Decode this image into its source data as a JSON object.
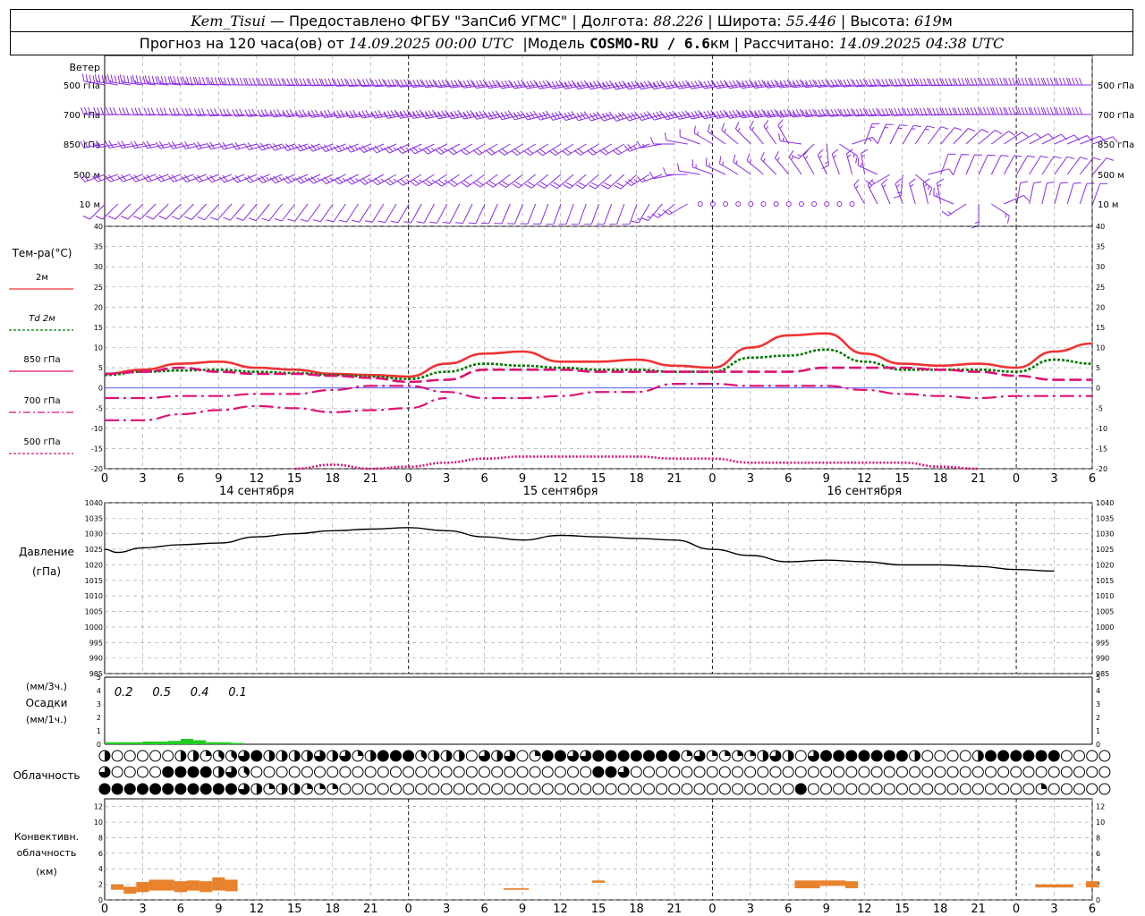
{
  "header": {
    "station": "Kem_Tisui",
    "provider": "— Предоставлено ФГБУ \"ЗапСиб УГМС\"",
    "lon_label": "Долгота:",
    "lon_value": "88.226",
    "lat_label": "Широта:",
    "lat_value": "55.446",
    "alt_label": "Высота:",
    "alt_value": "619",
    "alt_unit": "м",
    "forecast_prefix": "Прогноз на 120 часа(ов) от",
    "forecast_start": "14.09.2025 00:00 UTC",
    "model_label": "Модель",
    "model_name": "COSMO-RU / 6.6",
    "model_unit": "км",
    "calc_label": "Рассчитано:",
    "calc_time": "14.09.2025 04:38 UTC",
    "sep": "|"
  },
  "colors": {
    "wind": "#8a2be2",
    "t2m": "#ee3333",
    "td2m": "#007700",
    "t850": "#dd1177",
    "t700": "#dd1177",
    "t500": "#dd1177",
    "pressure": "#000000",
    "precip": "#22cc22",
    "conv": "#e8822c",
    "grid": "#999999"
  },
  "time_axis": {
    "hour_ticks": [
      "0",
      "3",
      "6",
      "9",
      "12",
      "15",
      "18",
      "21",
      "0",
      "3",
      "6",
      "9",
      "12",
      "15",
      "18",
      "21",
      "0",
      "3",
      "6",
      "9",
      "12",
      "15",
      "18",
      "21",
      "0",
      "3",
      "6"
    ],
    "dates": [
      "14 сентября",
      "15 сентября",
      "16 сентября"
    ]
  },
  "wind_panel": {
    "title": "Ветер",
    "levels": [
      "500 гПа",
      "700 гПа",
      "850 гПа",
      "500  м",
      "10   м"
    ]
  },
  "temp_panel": {
    "title": "Тем-ра(°C)",
    "legend": [
      "2м",
      "Td  2м",
      "850 гПа",
      "700 гПа",
      "500 гПа"
    ],
    "yticks": [
      "40",
      "35",
      "30",
      "25",
      "20",
      "15",
      "10",
      "5",
      "0",
      "-5",
      "-10",
      "-15",
      "-20"
    ]
  },
  "pressure_panel": {
    "title": "Давление",
    "unit": "(гПа)",
    "yticks": [
      "1040",
      "1035",
      "1030",
      "1025",
      "1020",
      "1015",
      "1010",
      "1005",
      "1000",
      "995",
      "990",
      "985"
    ]
  },
  "precip_panel": {
    "unit3h": "(мм/3ч.)",
    "title": "Осадки",
    "unit1h": "(мм/1ч.)",
    "yticks": [
      "5",
      "4",
      "3",
      "2",
      "1",
      "0"
    ],
    "totals": [
      "0.2",
      "0.5",
      "0.4",
      "0.1"
    ]
  },
  "cloud_panel": {
    "title": "Облачность"
  },
  "conv_panel": {
    "title1": "Конвективн.",
    "title2": "облачность",
    "unit": "(км)",
    "yticks": [
      "12",
      "10",
      "8",
      "6",
      "4",
      "2",
      "0"
    ]
  },
  "chart_data": [
    {
      "type": "line",
      "name": "temperature",
      "x_hours": [
        0,
        3,
        6,
        9,
        12,
        15,
        18,
        21,
        24,
        27,
        30,
        33,
        36,
        39,
        42,
        45,
        48,
        51,
        54,
        57,
        60,
        63,
        66,
        69,
        72,
        75,
        78
      ],
      "ylim": [
        -20,
        40
      ],
      "series": [
        {
          "name": "2м",
          "values": [
            3.5,
            4.5,
            6,
            6.5,
            5,
            4.5,
            3.5,
            3.2,
            2.8,
            6,
            8.5,
            9,
            6.5,
            6.5,
            7,
            5.5,
            5,
            10,
            13,
            13.5,
            8.5,
            6,
            5.5,
            6,
            5,
            9,
            11
          ]
        },
        {
          "name": "Td  2м",
          "values": [
            3.2,
            4,
            4.3,
            4.5,
            4,
            3.7,
            3.2,
            2.8,
            2.2,
            4,
            6,
            5.5,
            5,
            4.5,
            4.5,
            4,
            4,
            7.5,
            8,
            9.5,
            6.5,
            4.5,
            4.5,
            4.5,
            4,
            7,
            6
          ]
        },
        {
          "name": "850 гПа",
          "values": [
            3.5,
            4,
            5,
            4,
            3.5,
            3.5,
            3,
            2.5,
            1.5,
            2,
            4.5,
            4.5,
            4.5,
            4,
            4,
            4,
            4,
            4,
            4,
            5,
            5,
            5,
            4.5,
            4,
            3,
            2,
            2
          ]
        },
        {
          "name": "700 гПа",
          "values": [
            -2.5,
            -2.5,
            -2,
            -2,
            -1.5,
            -1.5,
            -0.5,
            0.5,
            0.5,
            -1,
            -2.5,
            -2.5,
            -2,
            -1,
            -1,
            1,
            1,
            0.5,
            0.5,
            0.5,
            -0.5,
            -1.5,
            -2,
            -2.5,
            -2,
            -2,
            -2
          ]
        },
        {
          "name": "",
          "values": [
            -8,
            -8,
            -6.5,
            -5.5,
            -4.5,
            -5,
            -6,
            -5.5,
            -5,
            -2.5,
            null,
            null,
            null,
            null,
            null,
            null,
            null,
            null,
            null,
            null,
            null,
            null,
            null,
            null,
            null,
            null,
            null
          ]
        },
        {
          "name": "500 гПа",
          "values": [
            null,
            null,
            null,
            null,
            null,
            -20,
            -19,
            -20,
            -19.5,
            -18.5,
            -17.5,
            -17,
            -17,
            -17,
            -17,
            -17.5,
            -17.5,
            -18.5,
            -18.5,
            -18.5,
            -18.5,
            -18.5,
            -19.5,
            -20,
            null,
            null,
            null
          ]
        }
      ]
    },
    {
      "type": "line",
      "name": "pressure",
      "x_hours": [
        0,
        1,
        3,
        6,
        9,
        12,
        15,
        18,
        21,
        24,
        27,
        30,
        33,
        36,
        39,
        42,
        45,
        48,
        51,
        54,
        57,
        60,
        63,
        66,
        69,
        72,
        75,
        78
      ],
      "ylim": [
        985,
        1040
      ],
      "series": [
        {
          "name": "Давление",
          "values": [
            1025,
            1024,
            1025.5,
            1026.5,
            1027,
            1029,
            1030,
            1031,
            1031.5,
            1032,
            1031,
            1029,
            1028,
            1029.5,
            1029,
            1028.5,
            1028,
            1025,
            1023,
            1021,
            1021.5,
            1021,
            1020,
            1020,
            1019.5,
            1018.5,
            1018
          ]
        }
      ]
    },
    {
      "type": "bar",
      "name": "precipitation_1h",
      "ylim": [
        0,
        5
      ],
      "x_hours": [
        0,
        1,
        2,
        3,
        4,
        5,
        6,
        7,
        8,
        9,
        10
      ],
      "values": [
        0.15,
        0.15,
        0.15,
        0.2,
        0.2,
        0.25,
        0.4,
        0.3,
        0.15,
        0.15,
        0.1
      ],
      "totals_3h": [
        0.2,
        0.5,
        0.4,
        0.1
      ]
    },
    {
      "type": "bar",
      "name": "convective_cloud",
      "ylim": [
        0,
        13
      ],
      "segments": [
        {
          "x0": 0.5,
          "x1": 1.5,
          "bottom": 1.3,
          "top": 2.0
        },
        {
          "x0": 1.5,
          "x1": 2.5,
          "bottom": 0.8,
          "top": 1.7
        },
        {
          "x0": 2.5,
          "x1": 3.5,
          "bottom": 1.0,
          "top": 2.3
        },
        {
          "x0": 3.5,
          "x1": 5.5,
          "bottom": 1.2,
          "top": 2.6
        },
        {
          "x0": 5.5,
          "x1": 6.5,
          "bottom": 1.0,
          "top": 2.4
        },
        {
          "x0": 6.5,
          "x1": 7.5,
          "bottom": 1.2,
          "top": 2.5
        },
        {
          "x0": 7.5,
          "x1": 8.5,
          "bottom": 1.0,
          "top": 2.4
        },
        {
          "x0": 8.5,
          "x1": 9.5,
          "bottom": 1.2,
          "top": 2.9
        },
        {
          "x0": 9.5,
          "x1": 10.5,
          "bottom": 1.1,
          "top": 2.6
        },
        {
          "x0": 31.5,
          "x1": 33.5,
          "bottom": 1.3,
          "top": 1.5
        },
        {
          "x0": 38.5,
          "x1": 39.5,
          "bottom": 2.2,
          "top": 2.5
        },
        {
          "x0": 54.5,
          "x1": 56.5,
          "bottom": 1.5,
          "top": 2.5
        },
        {
          "x0": 56.5,
          "x1": 58.5,
          "bottom": 1.8,
          "top": 2.5
        },
        {
          "x0": 58.5,
          "x1": 59.5,
          "bottom": 1.5,
          "top": 2.4
        },
        {
          "x0": 73.5,
          "x1": 76.5,
          "bottom": 1.6,
          "top": 2.0
        },
        {
          "x0": 77.5,
          "x1": 78.5,
          "bottom": 1.6,
          "top": 2.4
        }
      ]
    },
    {
      "type": "table",
      "name": "cloud_cover_octas",
      "rows": [
        [
          4,
          0,
          0,
          0,
          0,
          0,
          4,
          4,
          2,
          3,
          3,
          6,
          8,
          4,
          4,
          4,
          4,
          6,
          4,
          6,
          2,
          4,
          8,
          8,
          8,
          3,
          4,
          4,
          4,
          0,
          6,
          4,
          6,
          0,
          2,
          8,
          8,
          6,
          6,
          8,
          8,
          8,
          8,
          8,
          8,
          8,
          2,
          6,
          2,
          2,
          2,
          2,
          4,
          6,
          4,
          0,
          6,
          8,
          8,
          8,
          8,
          8,
          8,
          8,
          4,
          0,
          0,
          0,
          0,
          4,
          8,
          8,
          8,
          8,
          8,
          8,
          0,
          0,
          0,
          0
        ],
        [
          6,
          0,
          0,
          0,
          0,
          8,
          8,
          8,
          8,
          4,
          6,
          3,
          0,
          0,
          0,
          0,
          0,
          0,
          0,
          0,
          0,
          0,
          0,
          0,
          0,
          0,
          0,
          0,
          0,
          0,
          0,
          0,
          0,
          0,
          0,
          0,
          0,
          0,
          0,
          8,
          8,
          6,
          0,
          0,
          0,
          0,
          0,
          0,
          0,
          0,
          0,
          0,
          0,
          0,
          0,
          0,
          0,
          0,
          0,
          0,
          0,
          0,
          0,
          0,
          0,
          0,
          0,
          0,
          0,
          0,
          0,
          0,
          0,
          0,
          0,
          0,
          0,
          0,
          0,
          0
        ],
        [
          8,
          8,
          8,
          8,
          8,
          8,
          8,
          8,
          8,
          8,
          8,
          6,
          4,
          2,
          4,
          4,
          2,
          2,
          2,
          0,
          0,
          0,
          0,
          0,
          0,
          0,
          0,
          0,
          0,
          0,
          0,
          0,
          0,
          0,
          0,
          0,
          0,
          0,
          0,
          0,
          0,
          0,
          0,
          0,
          0,
          0,
          0,
          0,
          0,
          0,
          0,
          0,
          0,
          0,
          0,
          8,
          0,
          0,
          0,
          0,
          0,
          0,
          0,
          0,
          0,
          0,
          0,
          0,
          0,
          0,
          0,
          0,
          0,
          0,
          2,
          0,
          0,
          0,
          0,
          0
        ]
      ]
    },
    {
      "type": "table",
      "name": "wind_barbs",
      "levels": [
        "500 гПа",
        "700 гПа",
        "850 гПа",
        "500  м",
        "10   м"
      ],
      "x_hours": [
        0,
        6,
        12,
        18,
        24,
        30,
        36,
        42,
        48,
        54,
        60,
        66,
        72,
        78
      ],
      "direction_deg": [
        [
          280,
          275,
          270,
          268,
          265,
          262,
          260,
          258,
          260,
          262,
          265,
          268,
          270,
          270
        ],
        [
          270,
          268,
          265,
          262,
          260,
          258,
          255,
          252,
          258,
          262,
          265,
          268,
          270,
          270
        ],
        [
          260,
          258,
          255,
          250,
          245,
          240,
          238,
          240,
          300,
          330,
          20,
          40,
          60,
          70
        ],
        [
          250,
          250,
          248,
          245,
          240,
          235,
          230,
          228,
          290,
          320,
          350,
          20,
          30,
          40
        ],
        [
          225,
          225,
          220,
          215,
          210,
          205,
          200,
          200,
          260,
          300,
          330,
          350,
          10,
          20
        ]
      ],
      "speed_kt": [
        [
          45,
          45,
          48,
          50,
          50,
          52,
          52,
          55,
          60,
          65,
          70,
          70,
          70,
          70
        ],
        [
          30,
          30,
          32,
          34,
          35,
          35,
          36,
          38,
          40,
          45,
          50,
          50,
          50,
          50
        ],
        [
          20,
          20,
          22,
          24,
          24,
          22,
          20,
          18,
          6,
          5,
          6,
          8,
          10,
          10
        ],
        [
          20,
          22,
          22,
          24,
          24,
          22,
          20,
          18,
          6,
          5,
          6,
          8,
          10,
          10
        ],
        [
          10,
          10,
          12,
          12,
          12,
          10,
          10,
          8,
          4,
          4,
          5,
          6,
          8,
          8
        ]
      ]
    }
  ]
}
